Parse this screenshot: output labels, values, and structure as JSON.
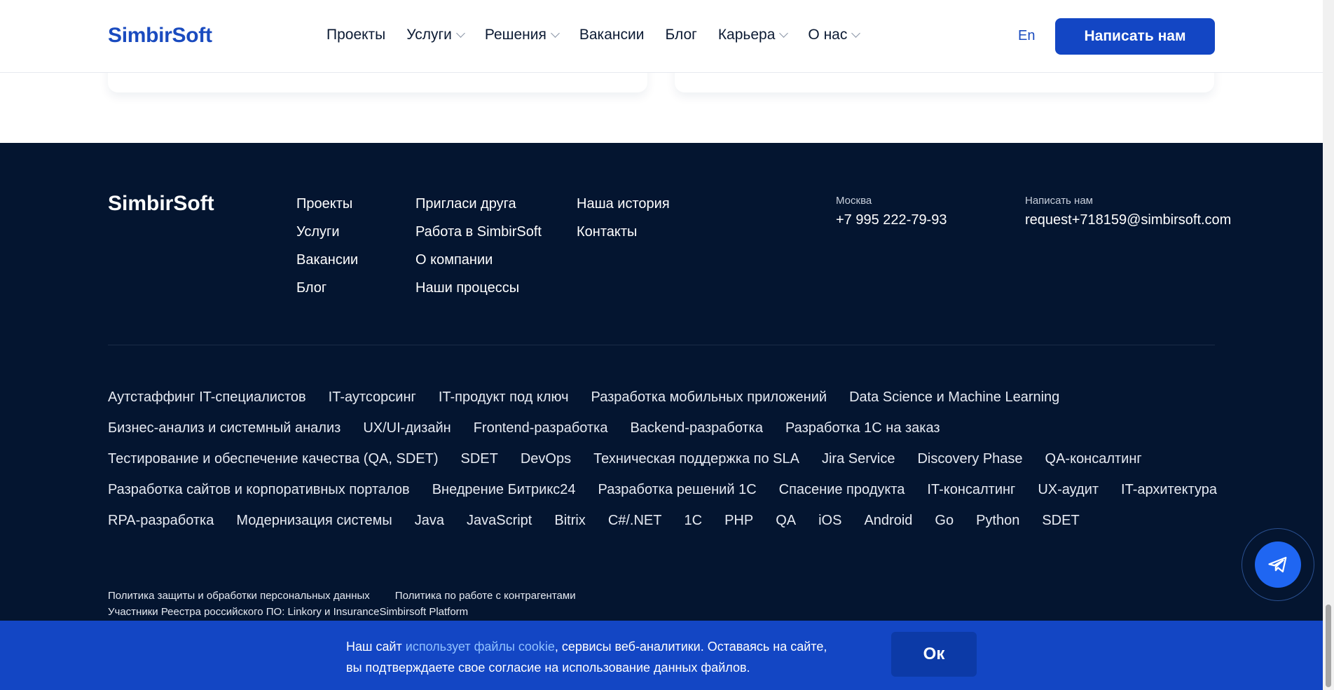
{
  "header": {
    "logo": "SimbirSoft",
    "nav": [
      {
        "label": "Проекты"
      },
      {
        "label": "Услуги"
      },
      {
        "label": "Решения"
      },
      {
        "label": "Вакансии"
      },
      {
        "label": "Блог"
      },
      {
        "label": "Карьера"
      },
      {
        "label": "О нас"
      }
    ],
    "lang": "En",
    "cta": "Написать нам"
  },
  "footer": {
    "logo": "SimbirSoft",
    "col1": [
      "Проекты",
      "Услуги",
      "Вакансии",
      "Блог"
    ],
    "col2": [
      "Пригласи друга",
      "Работа в SimbirSoft",
      "О компании",
      "Наши процессы"
    ],
    "col3": [
      "Наша история",
      "Контакты"
    ],
    "contacts": {
      "city_label": "Москва",
      "phone": "+7 995 222-79-93",
      "email_label": "Написать нам",
      "email": "request+718159@simbirsoft.com"
    },
    "tags": {
      "row1": [
        "Аутстаффинг IT-специалистов",
        "IT-аутсорсинг",
        "IT-продукт под ключ",
        "Разработка мобильных приложений",
        "Data Science и Machine Learning"
      ],
      "row2": [
        "Бизнес-анализ и системный анализ",
        "UX/UI-дизайн",
        "Frontend-разработка",
        "Backend-разработка",
        "Разработка 1С на заказ"
      ],
      "row3": [
        "Тестирование и обеспечение качества (QA, SDET)",
        "SDET",
        "DevOps",
        "Техническая поддержка по SLA",
        "Jira Service",
        "Discovery Phase",
        "QA-консалтинг"
      ],
      "row4": [
        "Разработка сайтов и корпоративных порталов",
        "Внедрение Битрикс24",
        "Разработка решений 1С",
        "Спасение продукта",
        "IT-консалтинг",
        "UX-аудит",
        "IT-архитектура"
      ],
      "row5": [
        "RPA-разработка",
        "Модернизация системы",
        "Java",
        "JavaScript",
        "Bitrix",
        "C#/.NET",
        "1С",
        "PHP",
        "QA",
        "iOS",
        "Android",
        "Go",
        "Python",
        "SDET"
      ]
    },
    "legal": {
      "privacy": "Политика защиты и обработки персональных данных",
      "contractors": "Политика по работе с контрагентами",
      "registry": "Участники Реестра российского ПО: Linkory и InsuranceSimbirsoft Platform"
    }
  },
  "cookie": {
    "text_before": "Наш сайт ",
    "link": "использует файлы cookie",
    "text_after": ", сервисы веб-аналитики. Оставаясь на сайте,",
    "line2": "вы подтверждаете свое согласие на использование данных файлов.",
    "ok": "Ок"
  },
  "icons": {
    "telegram": "telegram-icon",
    "chevron": "chevron-down-icon"
  }
}
